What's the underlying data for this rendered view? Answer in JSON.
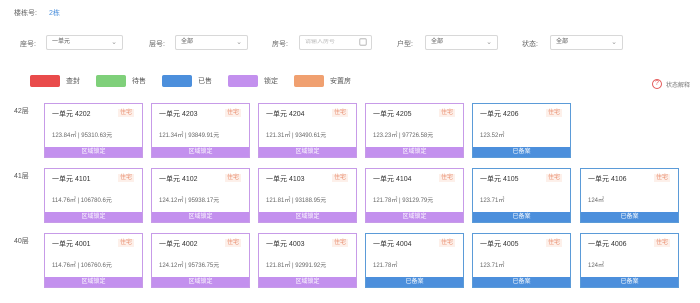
{
  "building": {
    "label": "楼栋号:",
    "value": "2栋"
  },
  "filters": {
    "entrance": {
      "label": "座号:",
      "value": "一单元"
    },
    "floor": {
      "label": "层号:",
      "value": "全部"
    },
    "room": {
      "label": "房号:",
      "placeholder": "请输入房号"
    },
    "layout": {
      "label": "户型:",
      "value": "全部"
    },
    "status": {
      "label": "状态:",
      "value": "全部"
    }
  },
  "legend": [
    {
      "label": "查封",
      "color": "#e94b4b"
    },
    {
      "label": "待售",
      "color": "#7fd07a"
    },
    {
      "label": "已售",
      "color": "#4c8fdc"
    },
    {
      "label": "锁定",
      "color": "#c390ee"
    },
    {
      "label": "安置房",
      "color": "#f0a070"
    }
  ],
  "help": {
    "label": "状态解释"
  },
  "floors": [
    {
      "label": "42层",
      "units": [
        {
          "name": "一单元 4202",
          "tag": "住宅",
          "info": "123.84㎡ | 95310.63元",
          "bar": "区域锁定",
          "status": "locked"
        },
        {
          "name": "一单元 4203",
          "tag": "住宅",
          "info": "121.34㎡ | 93849.91元",
          "bar": "区域锁定",
          "status": "locked"
        },
        {
          "name": "一单元 4204",
          "tag": "住宅",
          "info": "121.31㎡ | 93490.61元",
          "bar": "区域锁定",
          "status": "locked"
        },
        {
          "name": "一单元 4205",
          "tag": "住宅",
          "info": "123.23㎡ | 97726.58元",
          "bar": "区域锁定",
          "status": "locked"
        },
        {
          "name": "一单元 4206",
          "tag": "住宅",
          "info": "123.52㎡",
          "bar": "已备案",
          "status": "sold"
        }
      ]
    },
    {
      "label": "41层",
      "units": [
        {
          "name": "一单元 4101",
          "tag": "住宅",
          "info": "114.76㎡ | 106780.6元",
          "bar": "区域锁定",
          "status": "locked"
        },
        {
          "name": "一单元 4102",
          "tag": "住宅",
          "info": "124.12㎡ | 95938.17元",
          "bar": "区域锁定",
          "status": "locked"
        },
        {
          "name": "一单元 4103",
          "tag": "住宅",
          "info": "121.81㎡ | 93188.95元",
          "bar": "区域锁定",
          "status": "locked"
        },
        {
          "name": "一单元 4104",
          "tag": "住宅",
          "info": "121.78㎡ | 93129.79元",
          "bar": "区域锁定",
          "status": "locked"
        },
        {
          "name": "一单元 4105",
          "tag": "住宅",
          "info": "123.71㎡",
          "bar": "已备案",
          "status": "sold"
        },
        {
          "name": "一单元 4106",
          "tag": "住宅",
          "info": "124㎡",
          "bar": "已备案",
          "status": "sold"
        }
      ]
    },
    {
      "label": "40层",
      "units": [
        {
          "name": "一单元 4001",
          "tag": "住宅",
          "info": "114.76㎡ | 106760.6元",
          "bar": "区域锁定",
          "status": "locked"
        },
        {
          "name": "一单元 4002",
          "tag": "住宅",
          "info": "124.12㎡ | 95736.75元",
          "bar": "区域锁定",
          "status": "locked"
        },
        {
          "name": "一单元 4003",
          "tag": "住宅",
          "info": "121.81㎡ | 92991.92元",
          "bar": "区域锁定",
          "status": "locked"
        },
        {
          "name": "一单元 4004",
          "tag": "住宅",
          "info": "121.78㎡",
          "bar": "已备案",
          "status": "sold"
        },
        {
          "name": "一单元 4005",
          "tag": "住宅",
          "info": "123.71㎡",
          "bar": "已备案",
          "status": "sold"
        },
        {
          "name": "一单元 4006",
          "tag": "住宅",
          "info": "124㎡",
          "bar": "已备案",
          "status": "sold"
        }
      ]
    }
  ]
}
